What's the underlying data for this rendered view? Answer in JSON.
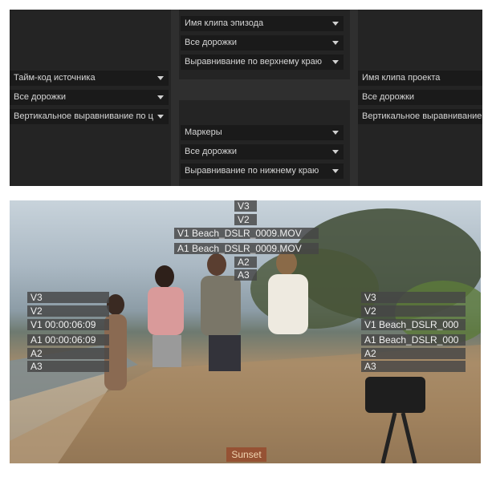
{
  "settings": {
    "left": {
      "dropdowns": [
        "Тайм-код источника",
        "Все дорожки",
        "Вертикальное выравнивание по ц"
      ]
    },
    "middle_top": {
      "dropdowns": [
        "Имя клипа эпизода",
        "Все дорожки",
        "Выравнивание по верхнему краю"
      ]
    },
    "middle_bottom": {
      "dropdowns": [
        "Маркеры",
        "Все дорожки",
        "Выравнивание по нижнему краю"
      ]
    },
    "right": {
      "dropdowns": [
        "Имя клипа проекта",
        "Все дорожки",
        "Вертикальное выравнивание"
      ]
    }
  },
  "preview": {
    "top_center": [
      "V3",
      "V2",
      "V1 Beach_DSLR_0009.MOV",
      "A1 Beach_DSLR_0009.MOV",
      "A2",
      "A3"
    ],
    "left": [
      "V3",
      "V2",
      "V1 00:00:06:09",
      "A1 00:00:06:09",
      "A2",
      "A3"
    ],
    "right": [
      "V3",
      "V2",
      "V1 Beach_DSLR_000",
      "A1 Beach_DSLR_000",
      "A2",
      "A3"
    ],
    "marker_label": "Sunset"
  }
}
